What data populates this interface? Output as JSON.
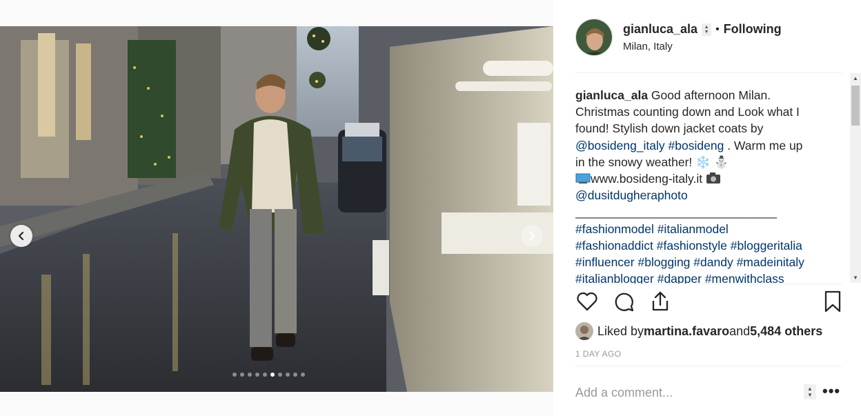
{
  "carousel": {
    "slide_count": 10,
    "active_index": 5,
    "prev_icon": "chevron-left-icon",
    "next_icon": "chevron-right-icon"
  },
  "post": {
    "username": "gianluca_ala",
    "follow_status": "Following",
    "bullet": "•",
    "location": "Milan, Italy"
  },
  "caption": {
    "username": "gianluca_ala",
    "text_1": " Good afternoon Milan.",
    "line_2": "Christmas counting down and Look what I",
    "line_3": "found! Stylish down jacket coats by",
    "mention_1": "@bosideng_italy",
    "hashtag_1": "#bosideng",
    "text_4": " . Warm me up",
    "line_5": "in the snowy weather! ❄️ ⛄",
    "website": "www.bosideng-italy.it",
    "mention_2": "@dusitdugheraphoto",
    "separator": "______________________________",
    "hashtags": [
      [
        "#fashionmodel",
        "#italianmodel"
      ],
      [
        "#fashionaddict",
        "#fashionstyle",
        "#bloggeritalia"
      ],
      [
        "#influencer",
        "#blogging",
        "#dandy",
        "#madeinitaly"
      ],
      [
        "#italianblogger",
        "#dapper",
        "#menwithclass"
      ]
    ]
  },
  "actions": {
    "like_icon": "heart-icon",
    "comment_icon": "comment-icon",
    "share_icon": "share-icon",
    "save_icon": "bookmark-icon"
  },
  "likes": {
    "prefix": "Liked by ",
    "liker": "martina.favaro",
    "middle": " and ",
    "others": "5,484 others"
  },
  "timestamp": "1 DAY AGO",
  "comment": {
    "placeholder": "Add a comment...",
    "more_label": "•••"
  },
  "colors": {
    "link": "#003569",
    "text": "#262626",
    "muted": "#999999",
    "divider": "#efefef"
  }
}
